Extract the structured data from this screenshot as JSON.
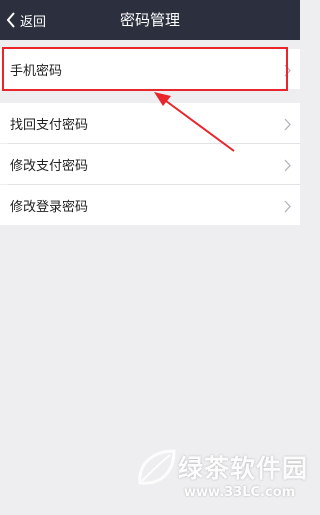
{
  "navbar": {
    "back_label": "返回",
    "title": "密码管理"
  },
  "items": [
    {
      "label": "手机密码"
    },
    {
      "label": "找回支付密码"
    },
    {
      "label": "修改支付密码"
    },
    {
      "label": "修改登录密码"
    }
  ],
  "watermark": {
    "brand": "绿茶软件园",
    "url": "www.33LC.com"
  },
  "colors": {
    "navbar_bg": "#2c2f3e",
    "page_bg": "#eeeef0",
    "highlight": "#e8262b"
  }
}
